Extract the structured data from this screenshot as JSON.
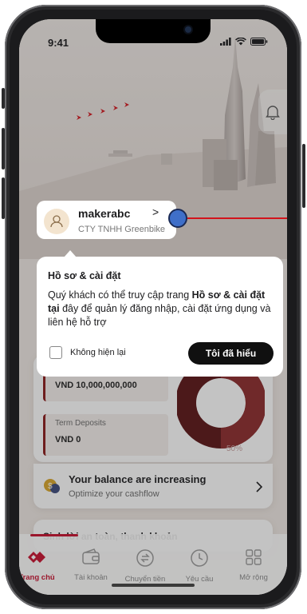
{
  "status_bar": {
    "time": "9:41"
  },
  "profile": {
    "username": "makerabc",
    "chevron": ">",
    "company": "CTY TNHH Greenbike"
  },
  "tooltip": {
    "title": "Hồ sơ & cài đặt",
    "body_before": "Quý khách có thể truy cập trang ",
    "body_bold": "Hồ sơ & cài đặt tại",
    "body_after": " đây để quản lý đăng nhập, cài đặt ứng dụng và liên hệ hỗ trợ",
    "checkbox_label": "Không hiện lại",
    "checkbox_checked": false,
    "confirm_button": "Tôi đã hiểu"
  },
  "accounts": {
    "first_value": "VND 10,000,000,000",
    "term_label": "Term Deposits",
    "term_value": "VND 0",
    "donut_percent_label": "50%",
    "donut_percent": 50
  },
  "balance_banner": {
    "title": "Your balance are increasing",
    "subtitle": "Optimize your cashflow"
  },
  "promo": {
    "title": "Sinh lời an toàn, thanh khoản"
  },
  "tabs": [
    {
      "label": "Trang chủ",
      "icon": "home-logo-icon",
      "active": true
    },
    {
      "label": "Tài khoản",
      "icon": "wallet-icon",
      "active": false
    },
    {
      "label": "Chuyển tiền",
      "icon": "transfer-icon",
      "active": false
    },
    {
      "label": "Yêu cầu",
      "icon": "clock-icon",
      "active": false
    },
    {
      "label": "Mở rộng",
      "icon": "grid-icon",
      "active": false
    }
  ],
  "colors": {
    "brand_red": "#c8102e",
    "donut_dark": "#5a1416",
    "hotspot_blue": "#3f6fc9",
    "pointer_red": "#d3141c"
  }
}
